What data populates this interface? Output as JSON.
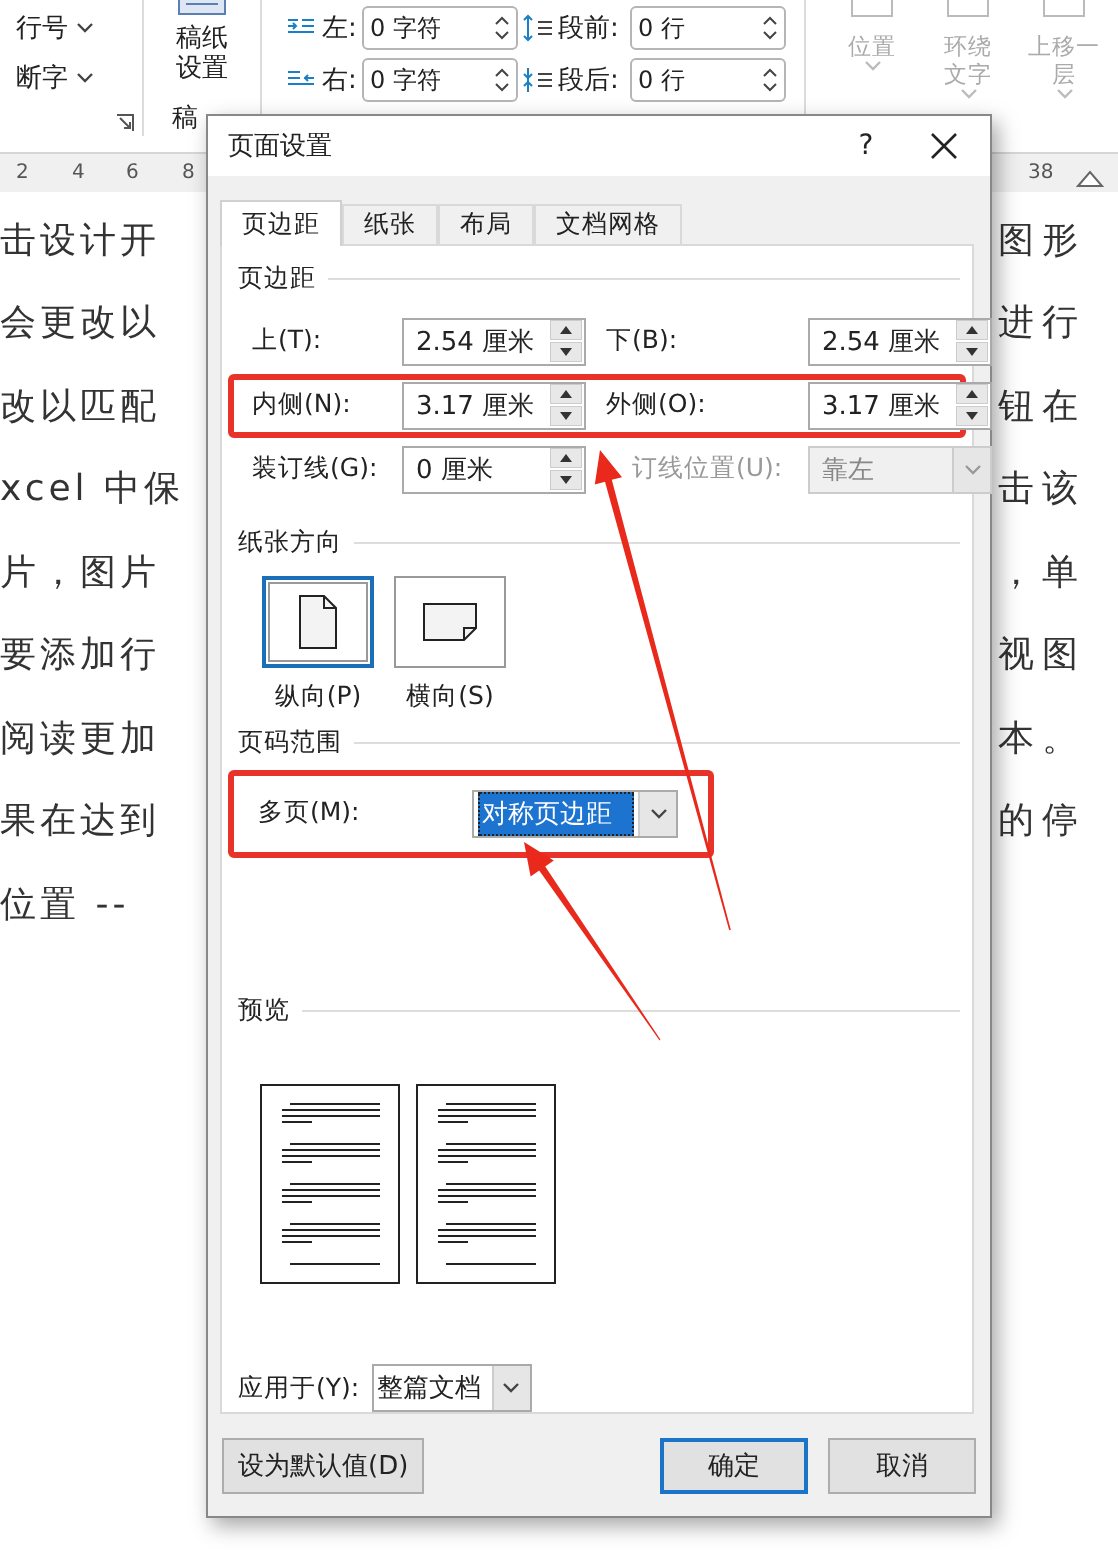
{
  "ribbon": {
    "paragraph_tools": [
      {
        "label": "行号"
      },
      {
        "label": "断字"
      }
    ],
    "manuscript": {
      "label": "稿纸设置",
      "group_label": "稿"
    },
    "indent": [
      {
        "label": "左:",
        "value": "0 字符",
        "kind": "indent-left"
      },
      {
        "label": "段前:",
        "value": "0 行",
        "kind": "space-before"
      },
      {
        "label": "右:",
        "value": "0 字符",
        "kind": "indent-right"
      },
      {
        "label": "段后:",
        "value": "0 行",
        "kind": "space-after"
      }
    ],
    "arrange": [
      {
        "label": "位置",
        "disabled": true
      },
      {
        "label": "环绕文字",
        "disabled": true
      },
      {
        "label": "上移一层",
        "disabled": true
      }
    ]
  },
  "ruler": [
    "2",
    "4",
    "6",
    "8",
    "38"
  ],
  "document": {
    "lines": [
      {
        "left": "击设计开",
        "right": "图形"
      },
      {
        "left": "会更改以",
        "right": "进行"
      },
      {
        "left": "改以匹配",
        "right": "钮在"
      },
      {
        "left": "xcel 中保",
        "right": "击该"
      },
      {
        "left": "片，图片",
        "right": "，单"
      },
      {
        "left": "要添加行",
        "right": "视图"
      },
      {
        "left": "阅读更加",
        "right": "本。"
      },
      {
        "left": "果在达到",
        "right": "的停"
      },
      {
        "left": "位置 --"
      }
    ]
  },
  "dialog": {
    "title": "页面设置",
    "help": "?",
    "tabs": [
      {
        "label": "页边距",
        "selected": true
      },
      {
        "label": "纸张",
        "selected": false
      },
      {
        "label": "布局",
        "selected": false
      },
      {
        "label": "文档网格",
        "selected": false
      }
    ],
    "margins": {
      "heading": "页边距",
      "rows": [
        {
          "highlighted": false,
          "fields": [
            {
              "label": "上(T):",
              "value": "2.54 厘米",
              "kind": "spin",
              "disabled": false
            },
            {
              "label": "下(B):",
              "value": "2.54 厘米",
              "kind": "spin",
              "disabled": false
            }
          ]
        },
        {
          "highlighted": true,
          "fields": [
            {
              "label": "内侧(N):",
              "value": "3.17 厘米",
              "kind": "spin",
              "disabled": false
            },
            {
              "label": "外侧(O):",
              "value": "3.17 厘米",
              "kind": "spin",
              "disabled": false
            }
          ]
        },
        {
          "highlighted": false,
          "fields": [
            {
              "label": "装订线(G):",
              "value": "0 厘米",
              "kind": "spin",
              "disabled": false
            },
            {
              "label": "订线位置(U):",
              "value": "靠左",
              "kind": "select",
              "disabled": true
            }
          ]
        }
      ]
    },
    "orientation": {
      "heading": "纸张方向",
      "options": [
        {
          "label": "纵向(P)",
          "kind": "portrait",
          "selected": true
        },
        {
          "label": "横向(S)",
          "kind": "landscape",
          "selected": false
        }
      ]
    },
    "pages": {
      "heading": "页码范围",
      "highlighted": true,
      "label": "多页(M):",
      "value": "对称页边距"
    },
    "preview": {
      "heading": "预览"
    },
    "apply": {
      "label": "应用于(Y):",
      "value": "整篇文档"
    },
    "buttons": [
      {
        "label": "设为默认值(D)",
        "kind": "default"
      },
      {
        "label": "确定",
        "kind": "primary"
      },
      {
        "label": "取消",
        "kind": "cancel"
      }
    ]
  }
}
